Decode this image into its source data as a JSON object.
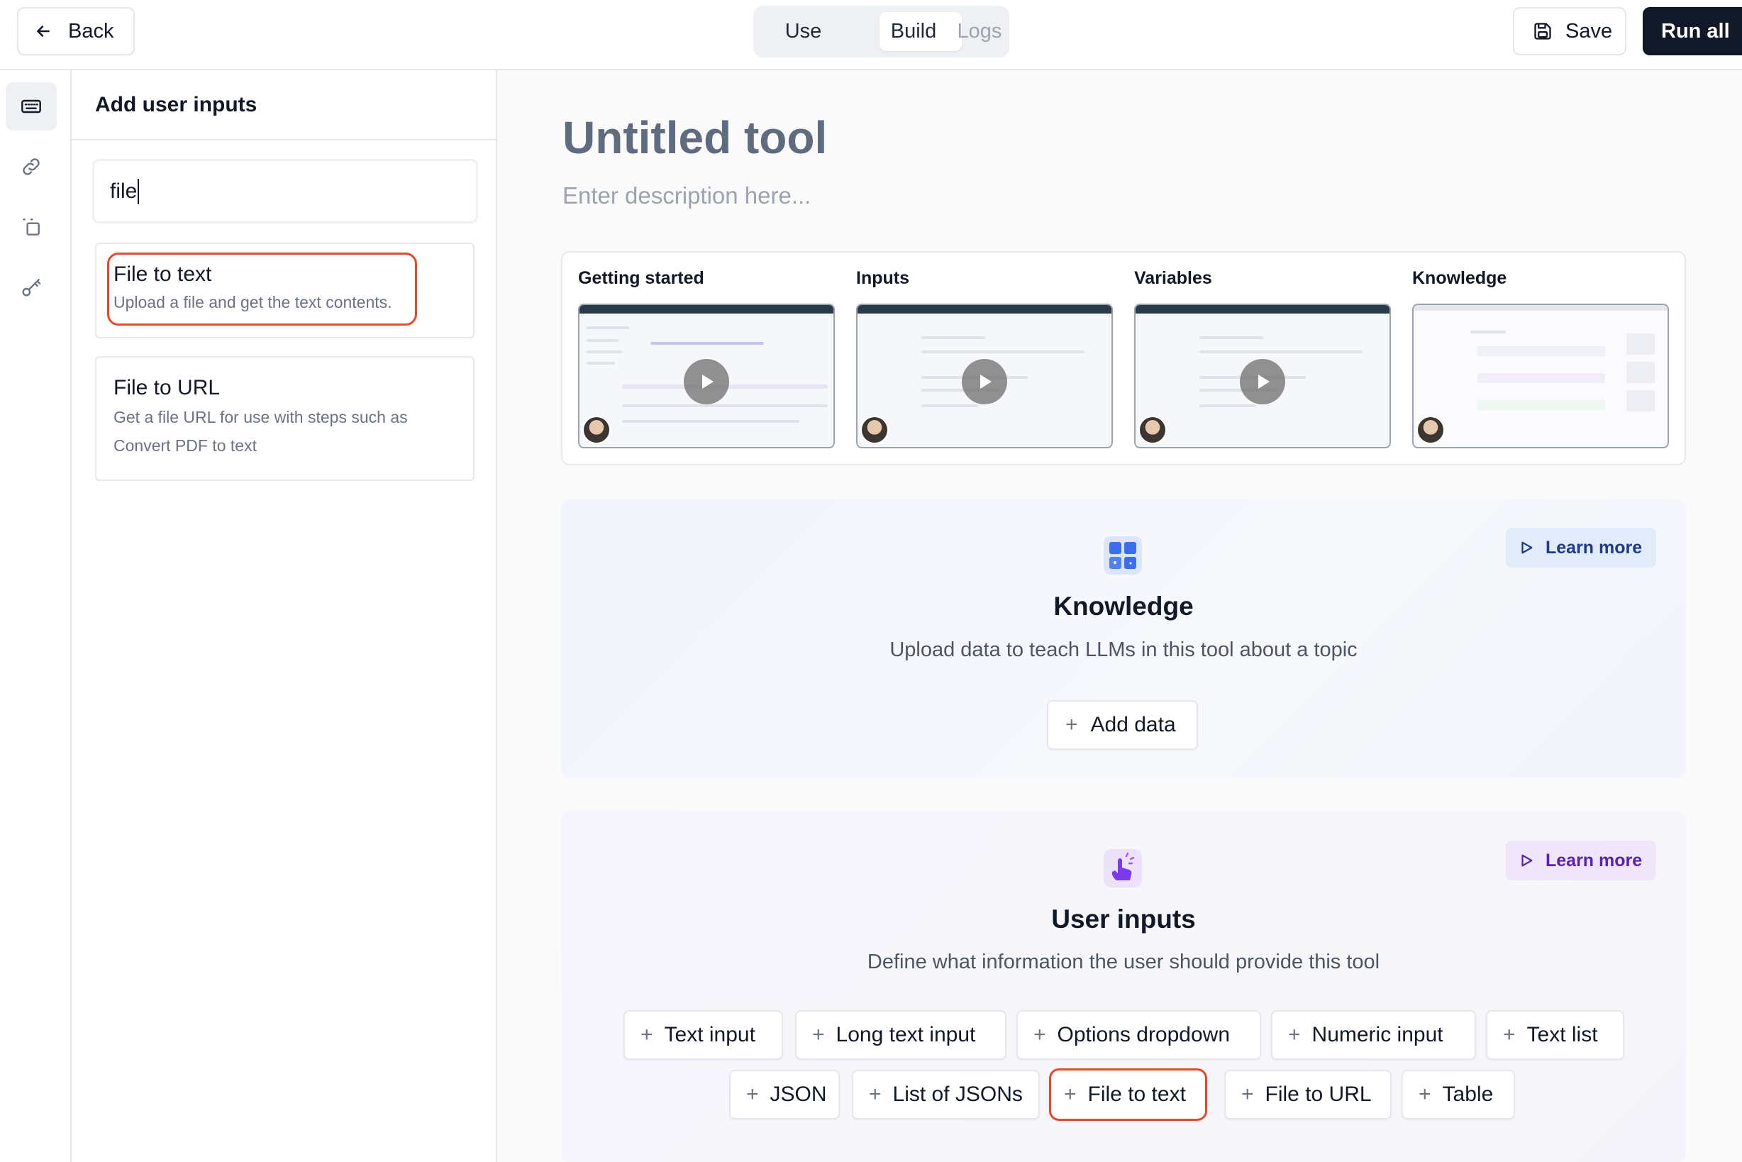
{
  "header": {
    "back_label": "Back",
    "tabs": [
      "Use",
      "Build",
      "Logs"
    ],
    "active_tab": "Build",
    "save_label": "Save",
    "run_label": "Run all"
  },
  "rail": {
    "items": [
      "keyboard-icon",
      "link-icon",
      "copy-icon",
      "key-icon"
    ],
    "active": "keyboard-icon"
  },
  "panel": {
    "title": "Add user inputs",
    "search_value": "file",
    "results": [
      {
        "title": "File to text",
        "desc": "Upload a file and get the text contents."
      },
      {
        "title": "File to URL",
        "desc": "Get a file URL for use with steps such as Convert PDF to text"
      }
    ]
  },
  "main": {
    "title": "Untitled tool",
    "description_placeholder": "Enter description here...",
    "videos": [
      {
        "title": "Getting started"
      },
      {
        "title": "Inputs"
      },
      {
        "title": "Variables"
      },
      {
        "title": "Knowledge"
      }
    ],
    "knowledge": {
      "title": "Knowledge",
      "desc": "Upload data to teach LLMs in this tool about a topic",
      "learn_more": "Learn more",
      "add_data": "Add data"
    },
    "user_inputs": {
      "title": "User inputs",
      "desc": "Define what information the user should provide this tool",
      "learn_more": "Learn more",
      "chips_row1": [
        "Text input",
        "Long text input",
        "Options dropdown",
        "Numeric input",
        "Text list"
      ],
      "chips_row2": [
        "JSON",
        "List of JSONs",
        "File to text",
        "File to URL",
        "Table"
      ]
    }
  },
  "colors": {
    "highlight": "#e04b2c",
    "primary_dark": "#111827",
    "learn_blue": "#1e3a8a",
    "learn_purple": "#5b21b6"
  }
}
